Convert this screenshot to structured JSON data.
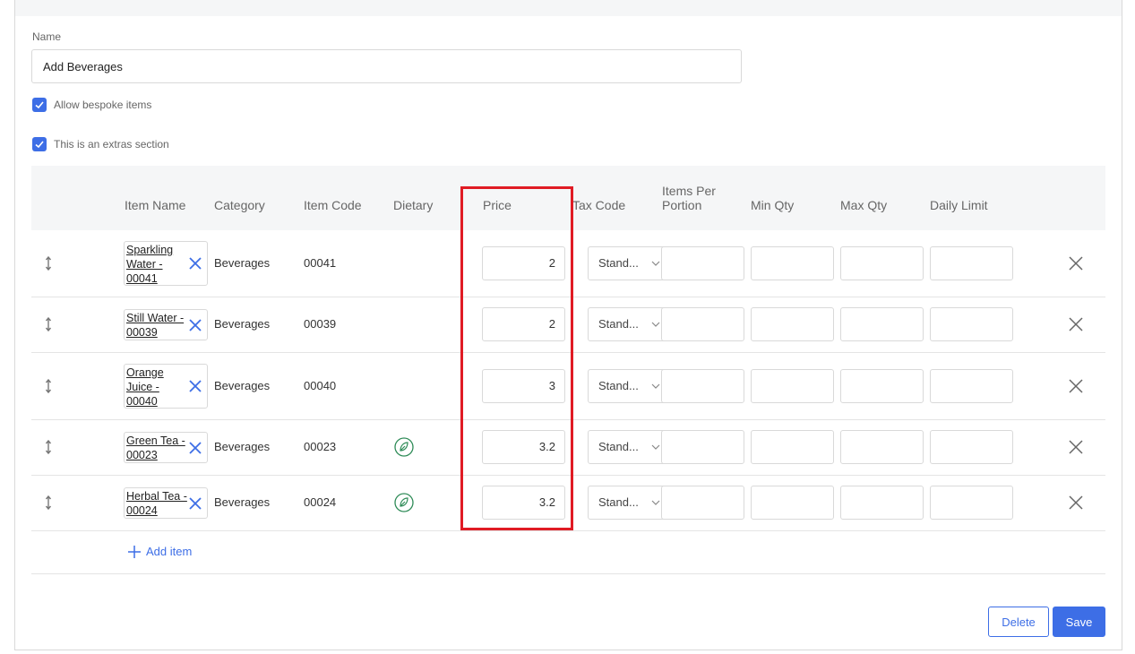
{
  "form": {
    "name_label": "Name",
    "name_value": "Add Beverages",
    "allow_bespoke_label": "Allow bespoke items",
    "allow_bespoke_checked": true,
    "extras_section_label": "This is an extras section",
    "extras_section_checked": true
  },
  "table": {
    "headers": {
      "item_name": "Item Name",
      "category": "Category",
      "item_code": "Item Code",
      "dietary": "Dietary",
      "price": "Price",
      "tax_code": "Tax Code",
      "items_per_portion_line1": "Items Per",
      "items_per_portion_line2": "Portion",
      "min_qty": "Min Qty",
      "max_qty": "Max Qty",
      "daily_limit": "Daily Limit"
    },
    "rows": [
      {
        "item_name": "Sparkling Water - 00041",
        "category": "Beverages",
        "item_code": "00041",
        "dietary_icon": "",
        "price": "2",
        "tax_code": "Stand..."
      },
      {
        "item_name": "Still Water - 00039",
        "category": "Beverages",
        "item_code": "00039",
        "dietary_icon": "",
        "price": "2",
        "tax_code": "Stand..."
      },
      {
        "item_name": "Orange Juice - 00040",
        "category": "Beverages",
        "item_code": "00040",
        "dietary_icon": "",
        "price": "3",
        "tax_code": "Stand..."
      },
      {
        "item_name": "Green Tea - 00023",
        "category": "Beverages",
        "item_code": "00023",
        "dietary_icon": "vegan-leaf-icon",
        "price": "3.2",
        "tax_code": "Stand..."
      },
      {
        "item_name": "Herbal Tea - 00024",
        "category": "Beverages",
        "item_code": "00024",
        "dietary_icon": "vegan-leaf-icon",
        "price": "3.2",
        "tax_code": "Stand..."
      }
    ],
    "add_item_label": "Add item"
  },
  "actions": {
    "delete_label": "Delete",
    "save_label": "Save"
  },
  "colors": {
    "accent": "#3d6ee6",
    "highlight": "#e01b24",
    "dietary_green": "#2e8b57"
  }
}
